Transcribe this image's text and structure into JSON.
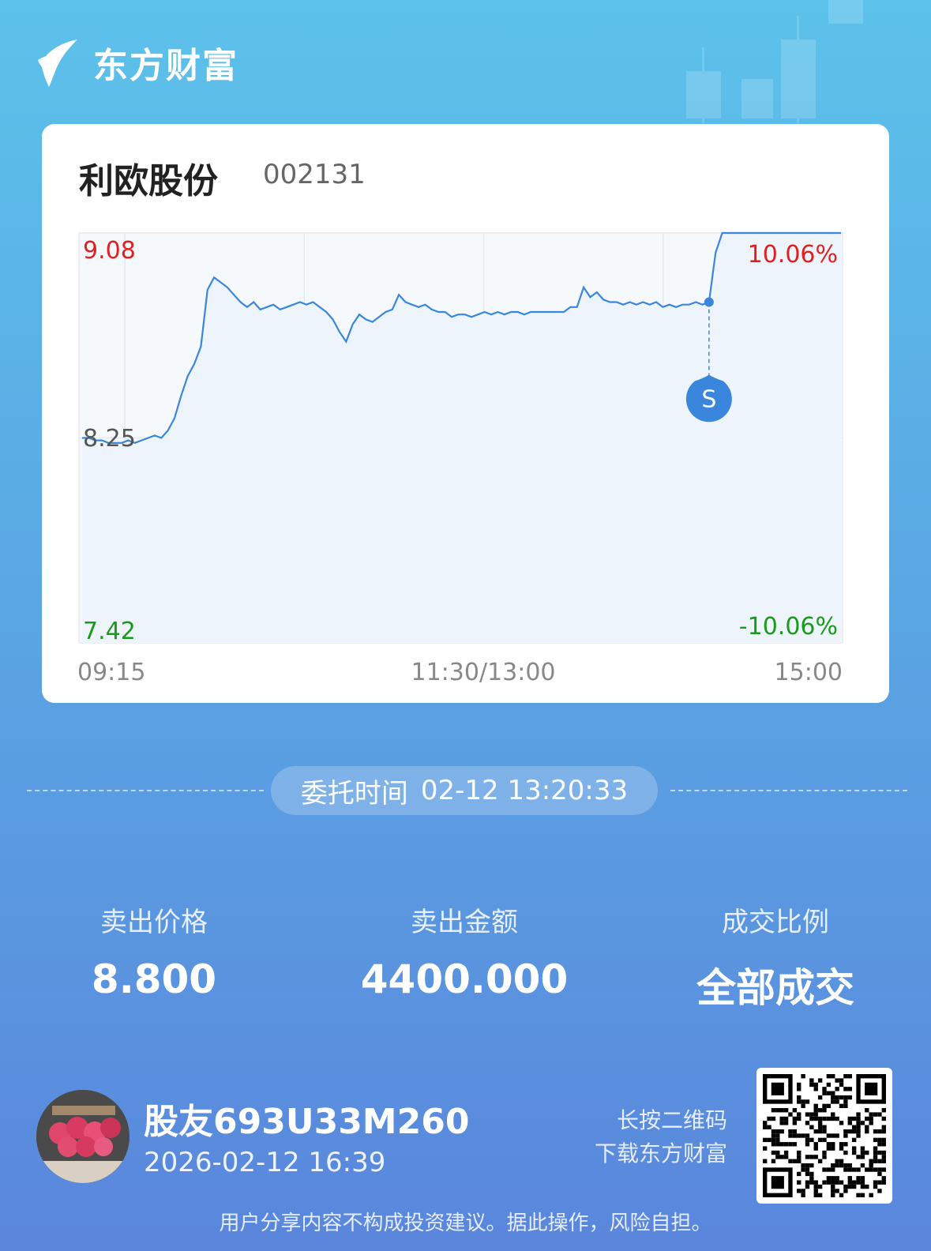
{
  "brand": {
    "name": "东方财富"
  },
  "stock": {
    "name": "利欧股份",
    "code": "002131"
  },
  "chart_data": {
    "type": "line",
    "title": "",
    "y_price_labels": {
      "high": "9.08",
      "mid": "8.25",
      "low": "7.42"
    },
    "y_percent_labels": {
      "high": "10.06%",
      "low": "-10.06%"
    },
    "x_labels": [
      "09:15",
      "11:30/13:00",
      "15:00"
    ],
    "ylim": [
      7.42,
      9.08
    ],
    "reference_price": 8.25,
    "grid": true,
    "series": [
      {
        "values": [
          8.25,
          8.25,
          8.24,
          8.24,
          8.23,
          8.23,
          8.23,
          8.24,
          8.23,
          8.24,
          8.25,
          8.26,
          8.25,
          8.28,
          8.33,
          8.42,
          8.5,
          8.55,
          8.62,
          8.85,
          8.9,
          8.88,
          8.86,
          8.83,
          8.8,
          8.78,
          8.8,
          8.77,
          8.78,
          8.79,
          8.77,
          8.78,
          8.79,
          8.8,
          8.79,
          8.8,
          8.78,
          8.76,
          8.73,
          8.68,
          8.64,
          8.71,
          8.75,
          8.73,
          8.72,
          8.74,
          8.76,
          8.77,
          8.83,
          8.8,
          8.79,
          8.78,
          8.79,
          8.77,
          8.76,
          8.76,
          8.74,
          8.75,
          8.75,
          8.74,
          8.75,
          8.76,
          8.75,
          8.76,
          8.75,
          8.76,
          8.76,
          8.75,
          8.76,
          8.76,
          8.76,
          8.76,
          8.76,
          8.76,
          8.78,
          8.78,
          8.86,
          8.82,
          8.84,
          8.81,
          8.8,
          8.8,
          8.79,
          8.8,
          8.79,
          8.8,
          8.79,
          8.8,
          8.78,
          8.79,
          8.78,
          8.79,
          8.79,
          8.8,
          8.79,
          8.8,
          9.0,
          9.08,
          9.08,
          9.08,
          9.08,
          9.08,
          9.08,
          9.08,
          9.08,
          9.08,
          9.08,
          9.08,
          9.08,
          9.08,
          9.08,
          9.08,
          9.08,
          9.08,
          9.08,
          9.08
        ],
        "trade_marker": {
          "index": 95,
          "label": "S"
        }
      }
    ]
  },
  "order": {
    "label": "委托时间",
    "time": "02-12 13:20:33"
  },
  "stats": [
    {
      "title": "卖出价格",
      "value": "8.800"
    },
    {
      "title": "卖出金额",
      "value": "4400.000"
    },
    {
      "title": "成交比例",
      "value": "全部成交"
    }
  ],
  "user": {
    "name": "股友693U33M260",
    "datetime": "2026-02-12 16:39"
  },
  "qr_hint": {
    "line1": "长按二维码",
    "line2": "下载东方财富"
  },
  "disclaimer": "用户分享内容不构成投资建议。据此操作，风险自担。",
  "colors": {
    "line": "#3a86dc",
    "up": "#e02020",
    "down": "#1a9a1a",
    "grid": "#e6e9ee"
  }
}
